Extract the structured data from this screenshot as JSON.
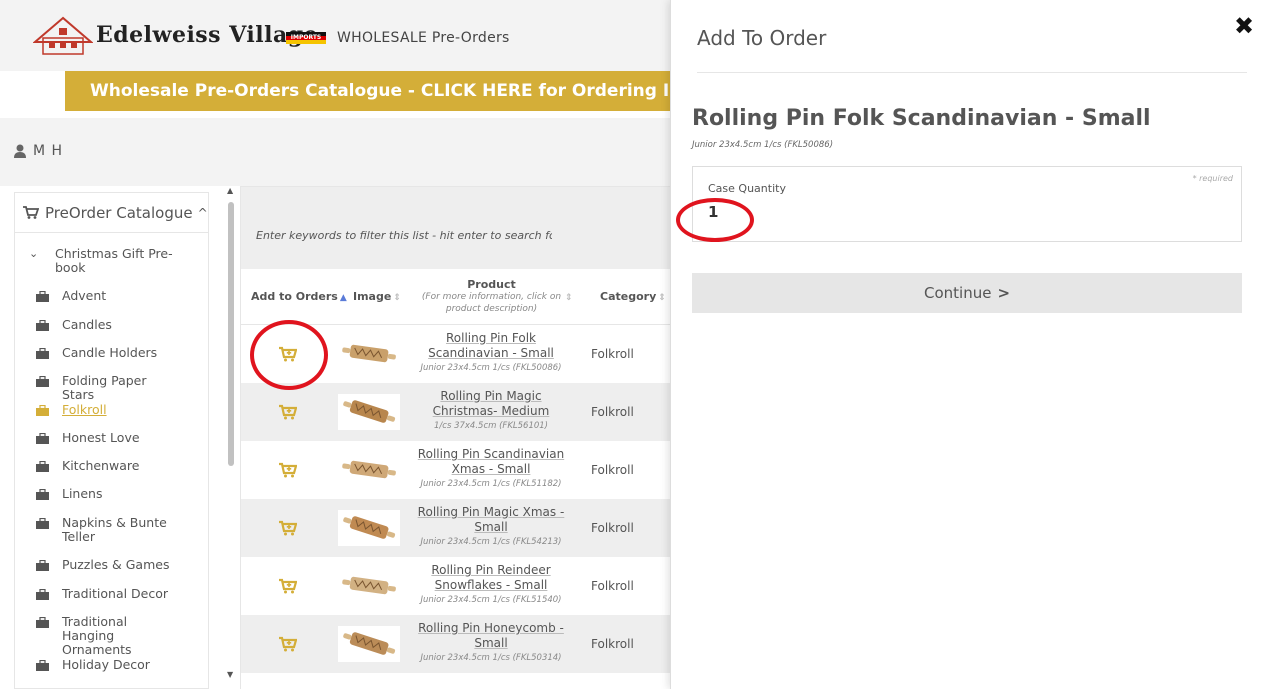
{
  "header": {
    "logo_name": "Edelweiss Village",
    "logo_imports": "IMPORTS",
    "subtitle": "WHOLESALE  Pre-Orders",
    "banner": "Wholesale Pre-Orders Catalogue - CLICK HERE for Ordering Instructions"
  },
  "user": {
    "name": "M H"
  },
  "sidebar": {
    "heading": "PreOrder Catalogue",
    "group": "Christmas Gift Pre-book",
    "items": [
      {
        "label": "Advent"
      },
      {
        "label": "Candles"
      },
      {
        "label": "Candle Holders"
      },
      {
        "label": "Folding Paper Stars"
      },
      {
        "label": "Folkroll",
        "active": true
      },
      {
        "label": "Honest Love"
      },
      {
        "label": "Kitchenware"
      },
      {
        "label": "Linens"
      },
      {
        "label": "Napkins & Bunte Teller"
      },
      {
        "label": "Puzzles & Games"
      },
      {
        "label": "Traditional Decor"
      },
      {
        "label": "Traditional Hanging Ornaments"
      },
      {
        "label": "Holiday Decor"
      }
    ]
  },
  "table": {
    "filter_placeholder": "Enter keywords to filter this list - hit enter to search for",
    "columns": {
      "add": "Add to Orders",
      "image": "Image",
      "product": "Product",
      "product_sub": "(For more information, click on product description)",
      "category": "Category"
    },
    "rows": [
      {
        "name": "Rolling Pin Folk Scandinavian - Small",
        "desc": "Junior 23x4.5cm 1/cs (FKL50086)",
        "category": "Folkroll"
      },
      {
        "name": "Rolling Pin Magic Christmas- Medium",
        "desc": "1/cs 37x4.5cm (FKL56101)",
        "category": "Folkroll"
      },
      {
        "name": "Rolling Pin Scandinavian Xmas - Small",
        "desc": "Junior 23x4.5cm 1/cs (FKL51182)",
        "category": "Folkroll"
      },
      {
        "name": "Rolling Pin Magic Xmas - Small",
        "desc": "Junior 23x4.5cm 1/cs (FKL54213)",
        "category": "Folkroll"
      },
      {
        "name": "Rolling Pin Reindeer Snowflakes - Small",
        "desc": "Junior 23x4.5cm 1/cs (FKL51540)",
        "category": "Folkroll"
      },
      {
        "name": "Rolling Pin Honeycomb - Small",
        "desc": "Junior 23x4.5cm 1/cs (FKL50314)",
        "category": "Folkroll"
      }
    ]
  },
  "panel": {
    "title": "Add To Order",
    "close": "✖",
    "product_title": "Rolling Pin Folk Scandinavian - Small",
    "product_desc": "Junior 23x4.5cm 1/cs (FKL50086)",
    "qty_label": "Case Quantity",
    "qty_required": "* required",
    "qty_value": "1",
    "continue_label": "Continue"
  },
  "colors": {
    "gold": "#d4ae38",
    "annotation_red": "#e0141e"
  }
}
